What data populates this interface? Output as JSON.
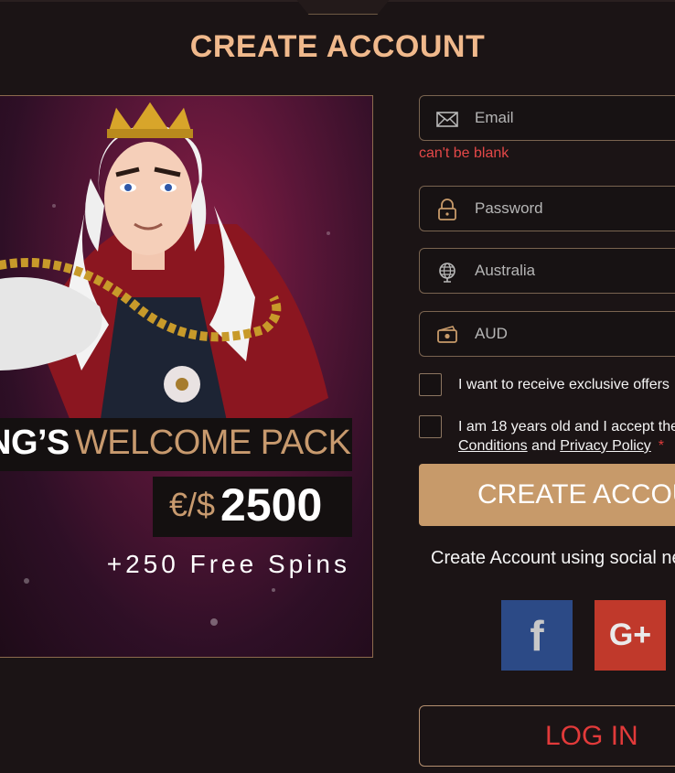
{
  "header": {
    "title": "CREATE ACCOUNT"
  },
  "promo": {
    "title_bold": "NG’S",
    "title_rest": "WELCOME PACK",
    "currency": "€/$",
    "amount": "2500",
    "free_spins": "+250 Free Spins"
  },
  "form": {
    "email": {
      "placeholder": "Email",
      "value": "",
      "icon": "envelope-icon"
    },
    "email_error": "can't be blank",
    "password": {
      "placeholder": "Password",
      "value": "",
      "icon": "lock-icon"
    },
    "country": {
      "value": "Australia",
      "icon": "globe-icon"
    },
    "currency": {
      "value": "AUD",
      "icon": "money-icon"
    },
    "offers_checkbox": {
      "label": "I want to receive exclusive offers",
      "checked": false
    },
    "terms_checkbox": {
      "label_start": "I am 18 years old and I accept the",
      "label_cut": " ",
      "conditions_link": "Conditions",
      "and_text": "and",
      "privacy_link": "Privacy Policy",
      "required_mark": "*",
      "checked": false
    },
    "submit_label": "CREATE ACCOUNT",
    "social_text": "Create Account using social ne",
    "facebook_label": "f",
    "google_label": "G+",
    "login_label": "LOG IN"
  },
  "colors": {
    "accent": "#c79a6a",
    "title": "#f0b98c",
    "error": "#e44848",
    "facebook": "#2c4a86",
    "google": "#c0392b"
  }
}
